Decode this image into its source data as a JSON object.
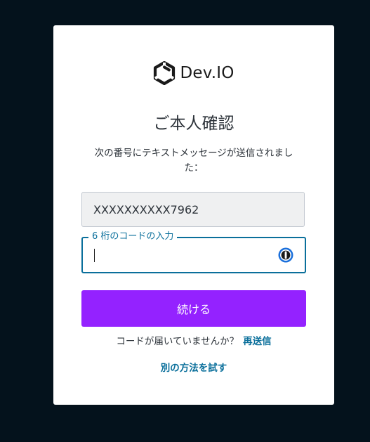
{
  "brand": {
    "logo_text": "Dev.IO",
    "logo_icon": "hexagon-logo-icon"
  },
  "page": {
    "title": "ご本人確認",
    "message": "次の番号にテキストメッセージが送信されました：",
    "phone_masked": "XXXXXXXXXX7962"
  },
  "code_input": {
    "label": "6 桁のコードの入力",
    "value": "",
    "password_manager_icon": "password-manager-icon"
  },
  "actions": {
    "continue_label": "続ける",
    "resend_prompt": "コードが届いていませんか？",
    "resend_label": "再送信",
    "alternative_label": "別の方法を試す"
  },
  "colors": {
    "background": "#04121c",
    "primary": "#9422ff",
    "link": "#0a6f9b",
    "focus_border": "#0a6f9b"
  }
}
